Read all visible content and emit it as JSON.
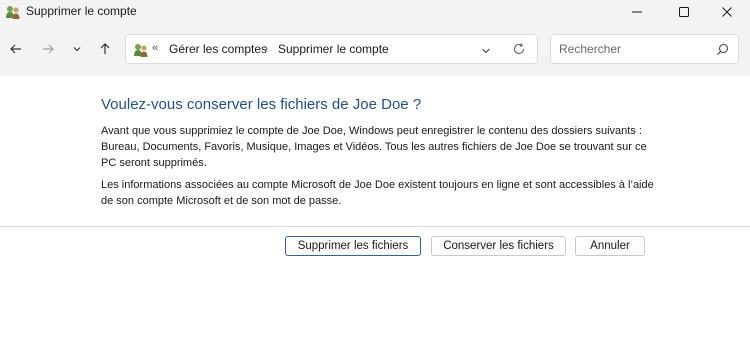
{
  "window": {
    "title": "Supprimer le compte"
  },
  "navigation": {
    "back_icon": "arrow-left-icon",
    "forward_icon": "arrow-right-icon",
    "recent_icon": "chevron-down-icon",
    "up_icon": "arrow-up-icon"
  },
  "addressbar": {
    "overflow": "«",
    "crumbs": [
      "Gérer les comptes",
      "Supprimer le compte"
    ],
    "separator": "›"
  },
  "search": {
    "placeholder": "Rechercher"
  },
  "dialog": {
    "heading": "Voulez-vous conserver les fichiers de Joe Doe ?",
    "paragraph1": "Avant que vous supprimiez le compte de Joe Doe, Windows peut enregistrer le contenu des dossiers suivants : Bureau, Documents, Favoris, Musique, Images et Vidéos. Tous les autres fichiers de Joe Doe se trouvant sur ce PC seront supprimés.",
    "paragraph2": "Les informations associées au compte Microsoft de Joe Doe existent toujours en ligne et sont accessibles à l’aide de son compte Microsoft et de son mot de passe."
  },
  "buttons": {
    "delete_files": "Supprimer les fichiers",
    "keep_files": "Conserver les fichiers",
    "cancel": "Annuler"
  },
  "colors": {
    "accent": "#1f4e9a",
    "primary_button_border": "#2a5fbf",
    "chrome_background": "#f3f3f3"
  }
}
